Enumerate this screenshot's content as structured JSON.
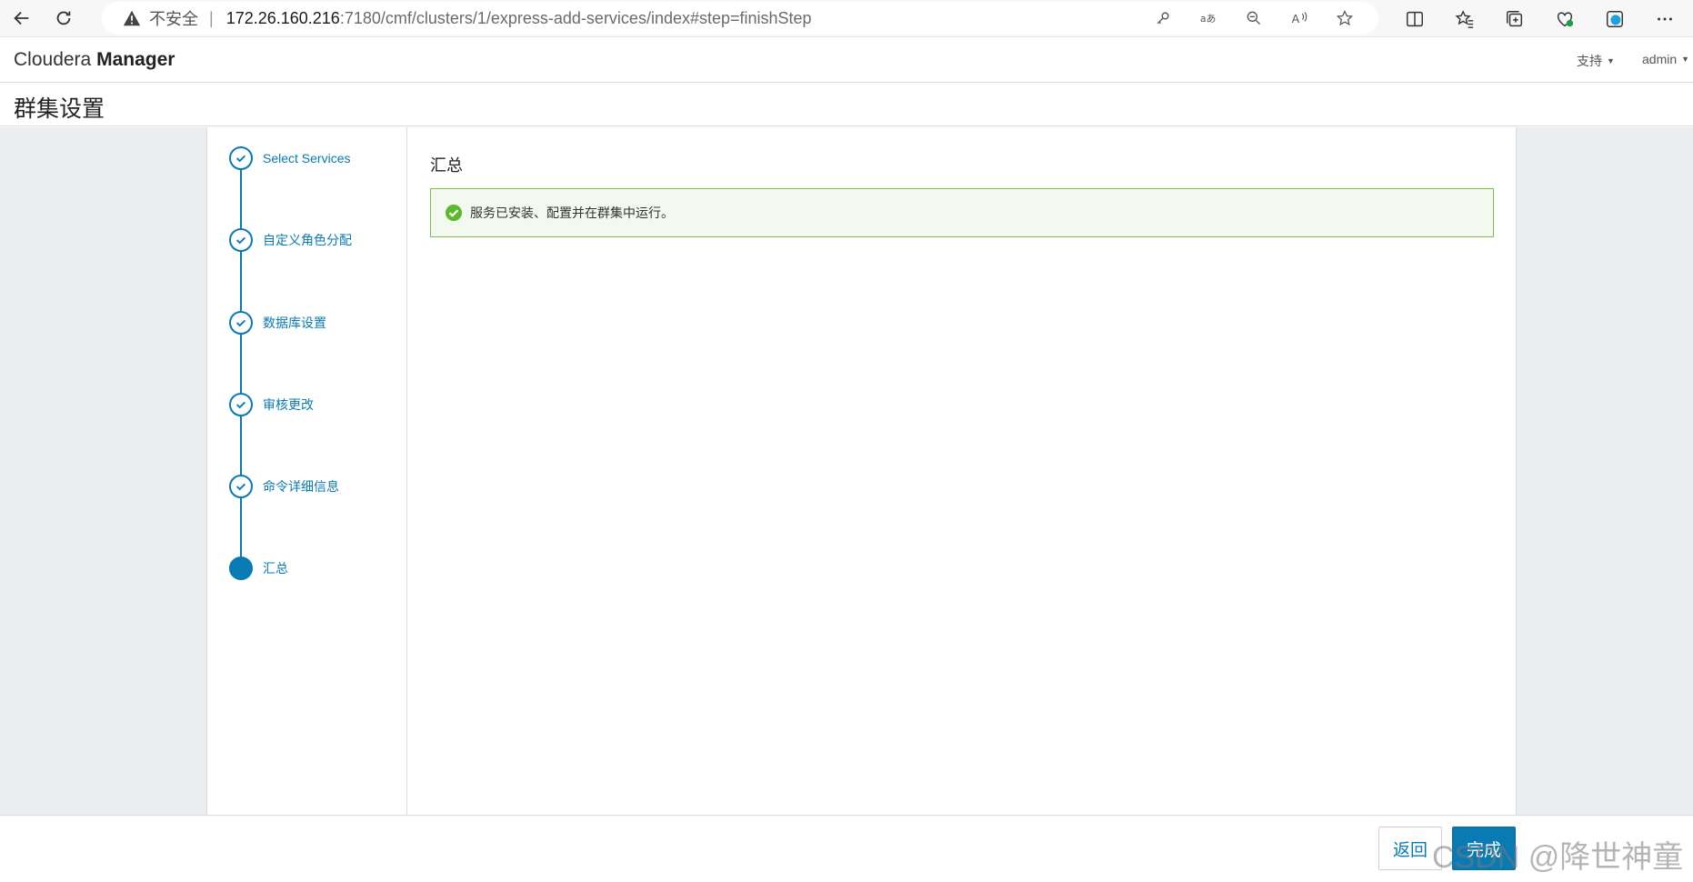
{
  "browser": {
    "security_label": "不安全",
    "separator": "|",
    "url_host": "172.26.160.216",
    "url_path": ":7180/cmf/clusters/1/express-add-services/index#step=finishStep",
    "icons": [
      "back-icon",
      "reload-icon",
      "warning-icon",
      "key-icon",
      "translate-icon",
      "zoom-out-icon",
      "read-aloud-icon",
      "favorite-star-icon",
      "split-screen-icon",
      "favorites-icon",
      "collections-icon",
      "browser-essentials-icon",
      "edge-icon",
      "more-icon"
    ]
  },
  "header": {
    "brand_light": "Cloudera",
    "brand_bold": "Manager",
    "support_menu": "支持",
    "user_menu": "admin"
  },
  "page": {
    "title": "群集设置"
  },
  "wizard": {
    "steps": [
      {
        "label": "Select Services",
        "state": "done"
      },
      {
        "label": "自定义角色分配",
        "state": "done"
      },
      {
        "label": "数据库设置",
        "state": "done"
      },
      {
        "label": "审核更改",
        "state": "done"
      },
      {
        "label": "命令详细信息",
        "state": "done"
      },
      {
        "label": "汇总",
        "state": "active"
      }
    ],
    "accent_color": "#0a7ab5"
  },
  "content": {
    "section_title": "汇总",
    "alert_message": "服务已安装、配置并在群集中运行。",
    "alert_color": "#7ac143"
  },
  "footer": {
    "back_label": "返回",
    "finish_label": "完成",
    "watermark": "CSDN @降世神童"
  }
}
